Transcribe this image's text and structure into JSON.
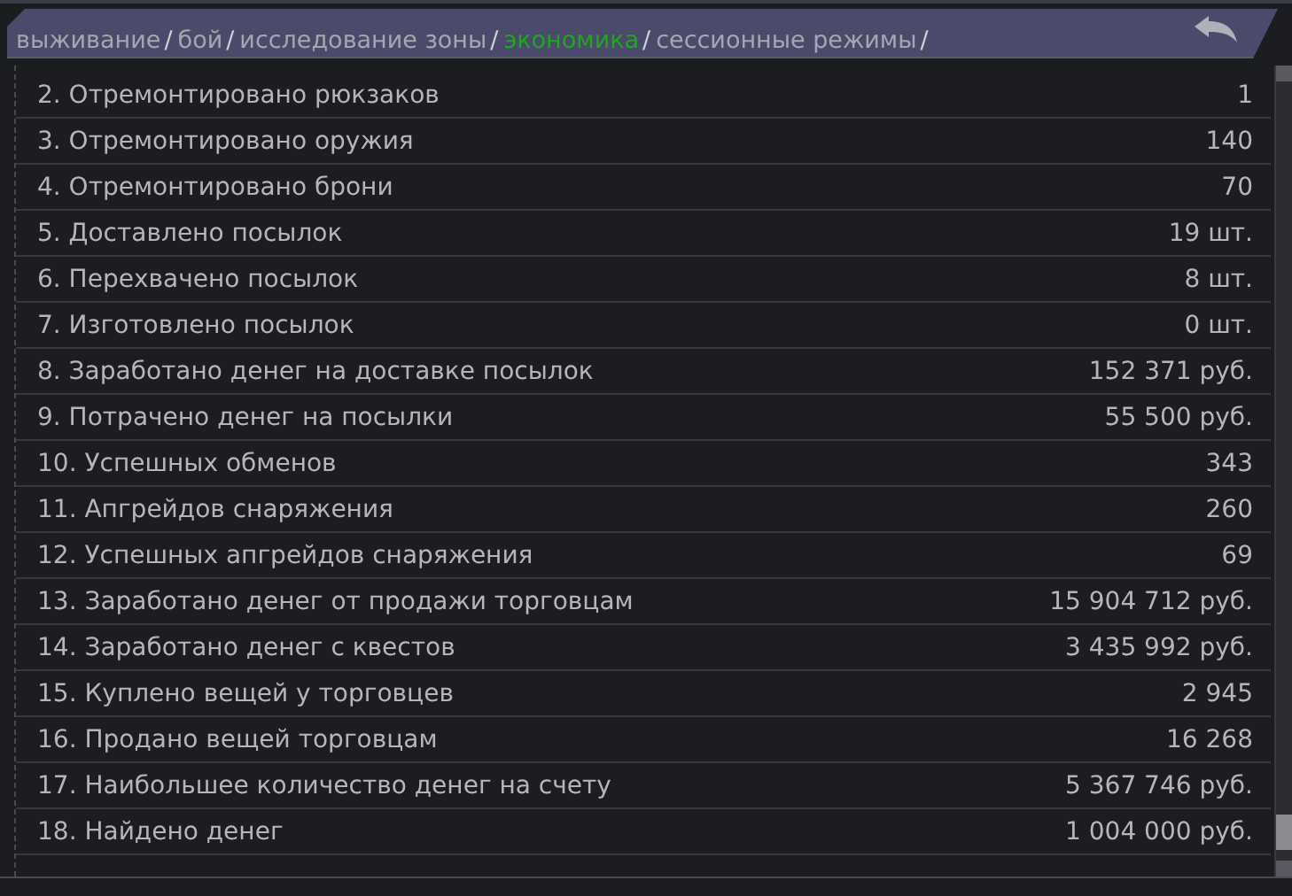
{
  "breadcrumbs": [
    {
      "label": "выживание",
      "selected": false,
      "separator": "/"
    },
    {
      "label": "бой",
      "selected": false,
      "separator": "/"
    },
    {
      "label": "исследование зоны",
      "selected": false,
      "separator": "/"
    },
    {
      "label": "экономика",
      "selected": true,
      "separator": "/"
    },
    {
      "label": "сессионные режимы",
      "selected": false,
      "separator": "/"
    }
  ],
  "stats": [
    {
      "label": "2. Отремонтировано рюкзаков",
      "value": "1"
    },
    {
      "label": "3. Отремонтировано оружия",
      "value": "140"
    },
    {
      "label": "4. Отремонтировано брони",
      "value": "70"
    },
    {
      "label": "5. Доставлено посылок",
      "value": "19 шт."
    },
    {
      "label": "6. Перехвачено посылок",
      "value": "8 шт."
    },
    {
      "label": "7. Изготовлено посылок",
      "value": "0 шт."
    },
    {
      "label": "8. Заработано денег на доставке посылок",
      "value": "152 371 руб."
    },
    {
      "label": "9. Потрачено денег на посылки",
      "value": "55 500 руб."
    },
    {
      "label": "10. Успешных обменов",
      "value": "343"
    },
    {
      "label": "11. Апгрейдов снаряжения",
      "value": "260"
    },
    {
      "label": "12. Успешных апгрейдов снаряжения",
      "value": "69"
    },
    {
      "label": "13. Заработано денег от продажи торговцам",
      "value": "15 904 712 руб."
    },
    {
      "label": "14. Заработано денег с квестов",
      "value": "3 435 992 руб."
    },
    {
      "label": "15. Куплено вещей у торговцев",
      "value": "2 945"
    },
    {
      "label": "16. Продано вещей торговцам",
      "value": "16 268"
    },
    {
      "label": "17. Наибольшее количество денег на счету",
      "value": "5 367 746 руб."
    },
    {
      "label": "18. Найдено денег",
      "value": "1 004 000 руб."
    }
  ]
}
